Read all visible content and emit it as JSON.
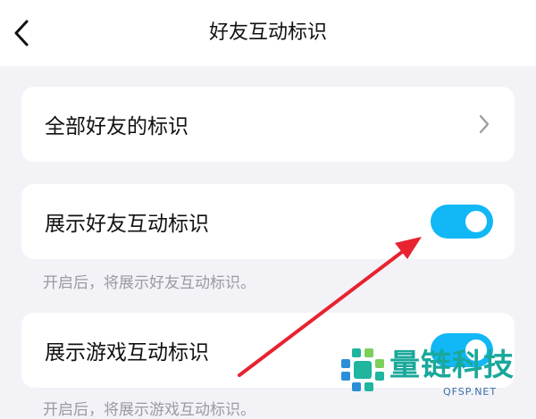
{
  "header": {
    "title": "好友互动标识",
    "back_icon": "chevron-left-icon"
  },
  "settings": {
    "all_friends_label": "全部好友的标识",
    "show_friend_label": "展示好友互动标识",
    "show_friend_enabled": true,
    "show_friend_hint": "开启后，将展示好友互动标识。",
    "show_game_label": "展示游戏互动标识",
    "show_game_enabled": true,
    "show_game_hint": "开启后，将展示游戏互动标识。"
  },
  "colors": {
    "toggle_on": "#12b7f5",
    "annotation_arrow": "#e8222f",
    "watermark": "#19a89a"
  },
  "watermark": {
    "text": "量链科技",
    "sub": "QFSP.NET"
  }
}
